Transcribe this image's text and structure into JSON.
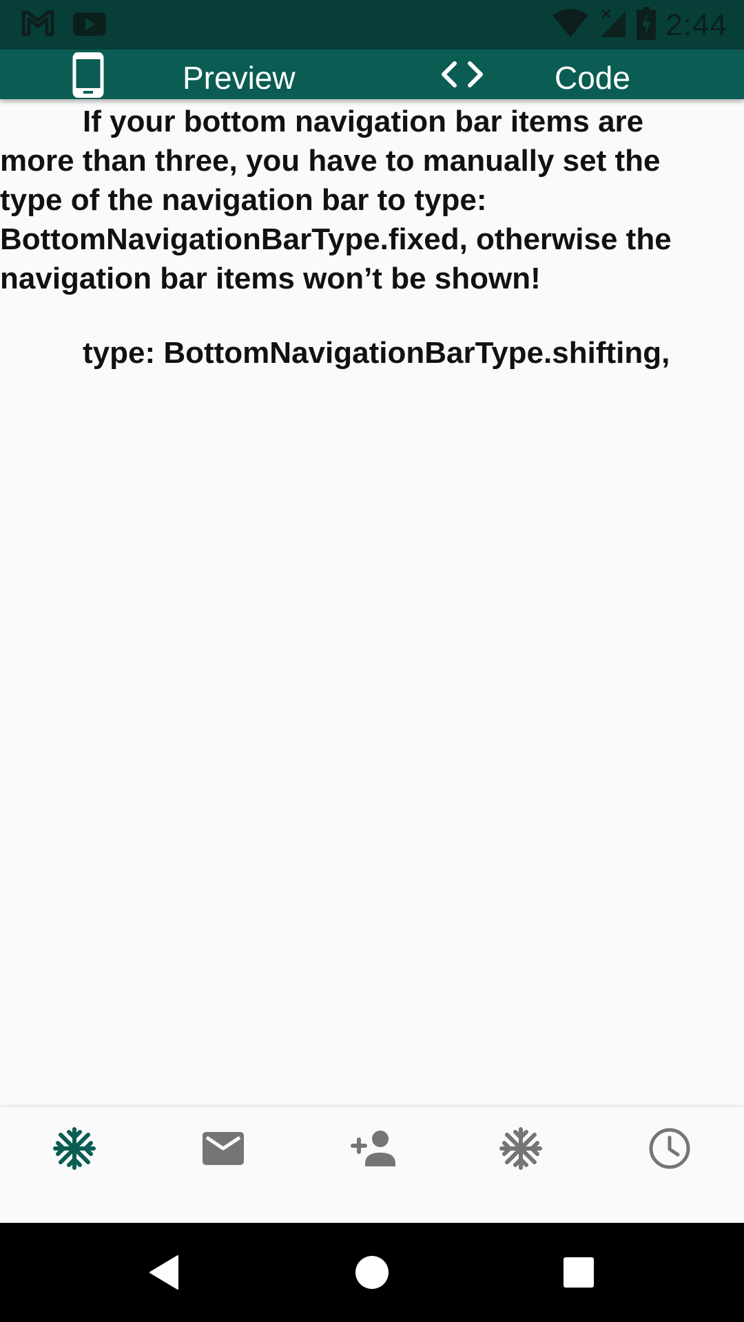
{
  "status_bar": {
    "time": "2:44",
    "icons": [
      "gmail-icon",
      "youtube-icon",
      "wifi-icon",
      "cell-signal-icon",
      "battery-charging-icon"
    ]
  },
  "tabs": [
    {
      "label": "Preview",
      "icon": "phone-icon",
      "selected": true
    },
    {
      "label": "Code",
      "icon": "code-icon",
      "selected": false
    }
  ],
  "content": {
    "description": "If your bottom navigation bar items are more than three,  you have to manually set the type of the navigation bar to type: BottomNavigationBarType.fixed, otherwise the navigation bar items won’t be shown!",
    "code": "type: BottomNavigationBarType.shifting,"
  },
  "bottom_nav": {
    "items": [
      {
        "icon": "ac-unit-icon",
        "selected": true
      },
      {
        "icon": "mail-icon",
        "selected": false
      },
      {
        "icon": "person-add-icon",
        "selected": false
      },
      {
        "icon": "ac-unit-icon",
        "selected": false
      },
      {
        "icon": "clock-icon",
        "selected": false
      }
    ],
    "active_color": "#0b5d53",
    "inactive_color": "#757575"
  },
  "system_nav": {
    "buttons": [
      "back-icon",
      "home-icon",
      "recents-icon"
    ]
  },
  "colors": {
    "status_bar": "#073f38",
    "app_bar": "#0b5d53",
    "background": "#fafafa",
    "text": "#111111"
  }
}
